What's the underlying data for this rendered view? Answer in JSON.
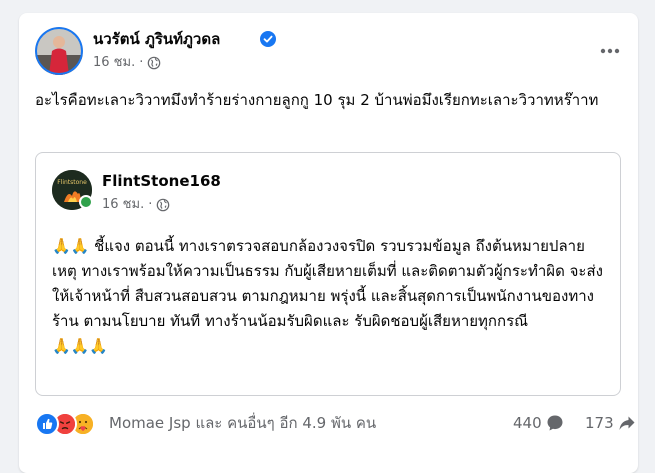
{
  "post": {
    "author": "นวรัตน์ ภูรินท์ภูวดล",
    "time": "16 ชม.",
    "separator": "·",
    "text": "อะไรคือทะเลาะวิวาทมึงทำร้ายร่างกายลูกกู 10 รุม 2 บ้านพ่อมึงเรียกทะเลาะวิวาทหร๊าาท",
    "privacy_icon": "globe-icon",
    "verified_icon": "verified-badge-icon"
  },
  "shared": {
    "author": "FlintStone168",
    "time": "16 ชม.",
    "separator": "·",
    "intro_emoji": "🙏🙏",
    "body": "ชี้แจง   ตอนนี้ ทางเราตรวจสอบกล้องวงจรปิด รวบรวมข้อมูล ถึงต้นหมายปลายเหตุ ทางเราพร้อมให้ความเป็นธรรม กับผู้เสียหายเต็มที่ และติดตามตัวผู้กระทำผิด จะส่งให้เจ้าหน้าที่ สืบสวนสอบสวน ตามกฎหมาย พรุ่งนี้  และสิ้นสุดการเป็นพนักงานของทางร้าน ตามนโยบาย ทันที  ทางร้านน้อมรับผิดและ รับผิดชอบผู้เสียหายทุกกรณี",
    "closing_emoji": "🙏🙏🙏"
  },
  "footer": {
    "reactions_label": "Momae Jsp และ คนอื่นๆ อีก 4.9 พัน คน",
    "reaction_icons": [
      "like-icon",
      "angry-icon",
      "care-icon"
    ],
    "comments_count": "440",
    "shares_count": "173"
  },
  "colors": {
    "like": "#1877f2",
    "angry": "#f0413e",
    "care": "#f7b125",
    "secondary_text": "#65676b",
    "verified": "#1877f2"
  }
}
